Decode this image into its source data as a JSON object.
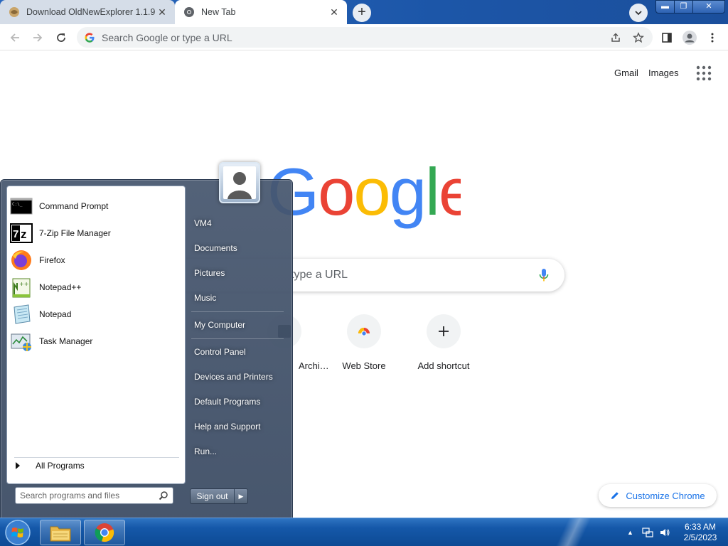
{
  "browser": {
    "tabs": [
      {
        "title": "Download OldNewExplorer 1.1.9",
        "active": false
      },
      {
        "title": "New Tab",
        "active": true
      }
    ],
    "omnibox_placeholder": "Search Google or type a URL"
  },
  "ntp": {
    "links": {
      "gmail": "Gmail",
      "images": "Images"
    },
    "search_placeholder": "type a URL",
    "shortcuts": [
      {
        "label": "Archi…",
        "icon": "archive-icon"
      },
      {
        "label": "Web Store",
        "icon": "web-store-icon"
      },
      {
        "label": "Add shortcut",
        "icon": "plus-icon"
      }
    ],
    "customize_label": "Customize Chrome"
  },
  "start_menu": {
    "programs": [
      {
        "label": "Command Prompt",
        "icon": "command-prompt-icon"
      },
      {
        "label": "7-Zip File Manager",
        "icon": "7zip-icon"
      },
      {
        "label": "Firefox",
        "icon": "firefox-icon"
      },
      {
        "label": "Notepad++",
        "icon": "notepad-plus-plus-icon"
      },
      {
        "label": "Notepad",
        "icon": "notepad-icon"
      },
      {
        "label": "Task Manager",
        "icon": "task-manager-icon"
      }
    ],
    "all_programs": "All Programs",
    "search_placeholder": "Search programs and files",
    "places": [
      "VM4",
      "Documents",
      "Pictures",
      "Music",
      "My Computer",
      "Control Panel",
      "Devices and Printers",
      "Default Programs",
      "Help and Support",
      "Run..."
    ],
    "signout_label": "Sign out"
  },
  "taskbar": {
    "time": "6:33 AM",
    "date": "2/5/2023"
  },
  "colors": {
    "taskbar": "#1558a9",
    "accent": "#1a73e8"
  }
}
